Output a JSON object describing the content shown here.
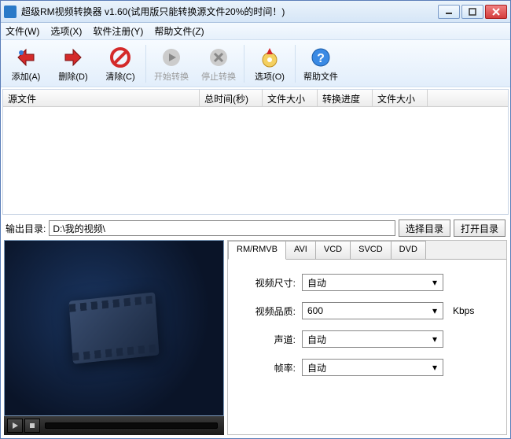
{
  "title": "超级RM视频转换器 v1.60(试用版只能转换源文件20%的时间！)",
  "menu": {
    "file": "文件(W)",
    "option": "选项(X)",
    "register": "软件注册(Y)",
    "help": "帮助文件(Z)"
  },
  "toolbar": {
    "add": "添加(A)",
    "delete": "删除(D)",
    "clear": "清除(C)",
    "start": "开始转换",
    "stop": "停止转换",
    "options": "选项(O)",
    "help": "帮助文件"
  },
  "columns": {
    "source": "源文件",
    "duration": "总时间(秒)",
    "size1": "文件大小",
    "progress": "转换进度",
    "size2": "文件大小"
  },
  "output": {
    "label": "输出目录:",
    "path": "D:\\我的视频\\",
    "browse": "选择目录",
    "open": "打开目录"
  },
  "tabs": {
    "rm": "RM/RMVB",
    "avi": "AVI",
    "vcd": "VCD",
    "svcd": "SVCD",
    "dvd": "DVD"
  },
  "form": {
    "videoSizeLabel": "视频尺寸:",
    "videoSizeValue": "自动",
    "qualityLabel": "视频品质:",
    "qualityValue": "600",
    "qualityUnit": "Kbps",
    "audioLabel": "声道:",
    "audioValue": "自动",
    "fpsLabel": "帧率:",
    "fpsValue": "自动"
  }
}
